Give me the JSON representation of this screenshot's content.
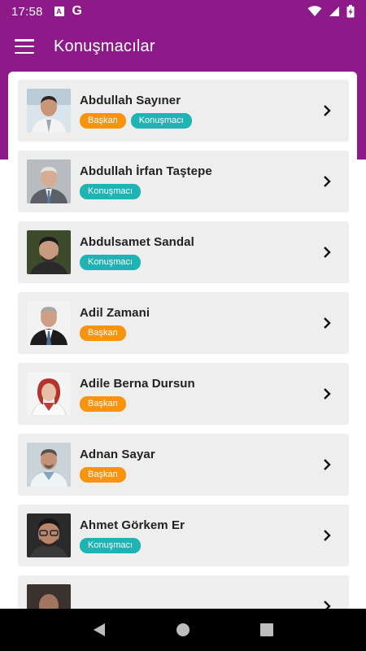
{
  "status_bar": {
    "time": "17:58",
    "icons": [
      "accessibility-a-icon",
      "google-g-icon",
      "wifi-icon",
      "signal-icon",
      "battery-charging-icon"
    ]
  },
  "app_bar": {
    "title": "Konuşmacılar",
    "menu_icon": "hamburger-icon"
  },
  "colors": {
    "primary": "#8e1a8a",
    "baskan_badge": "#f7930e",
    "konusmaci_badge": "#1fb3b3",
    "card_bg": "#eeeeee"
  },
  "speakers": [
    {
      "name": "Abdullah Sayıner",
      "badges": [
        "Başkan",
        "Konuşmacı"
      ]
    },
    {
      "name": "Abdullah İrfan Taştepe",
      "badges": [
        "Konuşmacı"
      ]
    },
    {
      "name": "Abdulsamet Sandal",
      "badges": [
        "Konuşmacı"
      ]
    },
    {
      "name": "Adil Zamani",
      "badges": [
        "Başkan"
      ]
    },
    {
      "name": "Adile Berna Dursun",
      "badges": [
        "Başkan"
      ]
    },
    {
      "name": "Adnan Sayar",
      "badges": [
        "Başkan"
      ]
    },
    {
      "name": "Ahmet Görkem Er",
      "badges": [
        "Konuşmacı"
      ]
    },
    {
      "name": "",
      "badges": []
    }
  ],
  "nav_bar": {
    "buttons": [
      "back-icon",
      "home-icon",
      "recents-icon"
    ]
  }
}
